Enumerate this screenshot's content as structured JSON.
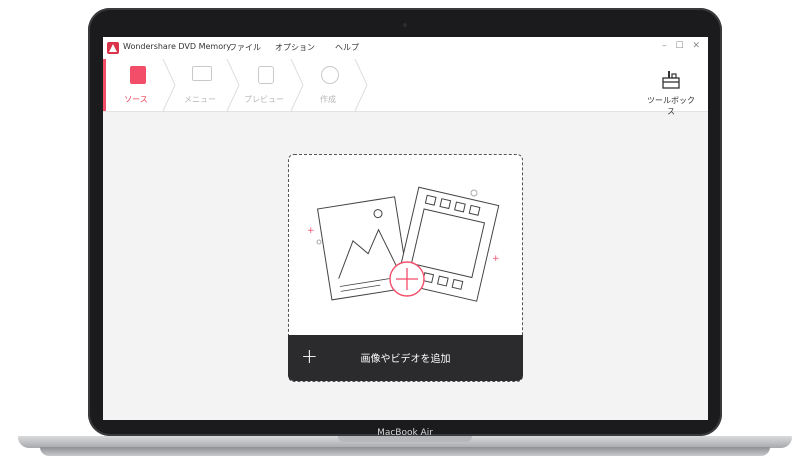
{
  "device": {
    "brand": "MacBook Air"
  },
  "app": {
    "title": "Wondershare DVD Memory",
    "menus": [
      "ファイル",
      "オプション",
      "ヘルプ"
    ],
    "window_controls": "– ☐ ✕"
  },
  "steps": [
    {
      "label": "ソース",
      "icon": "source-icon",
      "active": true
    },
    {
      "label": "メニュー",
      "icon": "menu-icon",
      "active": false
    },
    {
      "label": "プレビュー",
      "icon": "preview-icon",
      "active": false
    },
    {
      "label": "作成",
      "icon": "burn-disc-icon",
      "active": false
    }
  ],
  "toolbox": {
    "label": "ツールボックス",
    "icon": "toolbox-icon"
  },
  "main": {
    "add_label": "画像やビデオを追加",
    "add_icon": "plus-icon"
  },
  "colors": {
    "accent": "#f24e6a",
    "addbar": "#2b2b2d"
  }
}
